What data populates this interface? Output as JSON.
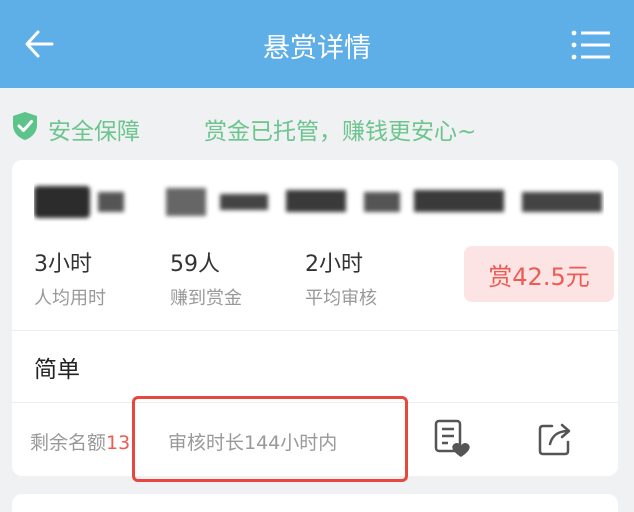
{
  "header": {
    "title": "悬赏详情",
    "back_icon": "arrow-left-icon",
    "menu_icon": "menu-icon",
    "background": "#5eaee8"
  },
  "safety": {
    "label": "安全保障",
    "description": "赏金已托管，赚钱更安心~",
    "color": "#6cc48e"
  },
  "task": {
    "title": "",
    "stats": [
      {
        "value": "3小时",
        "label": "人均用时"
      },
      {
        "value": "59人",
        "label": "赚到赏金"
      },
      {
        "value": "2小时",
        "label": "平均审核"
      }
    ],
    "reward": "赏42.5元",
    "difficulty": "简单",
    "remaining_label": "剩余名额",
    "remaining_count": "13",
    "review_duration": "审核时长144小时内"
  },
  "colors": {
    "accent_red": "#ef5a55",
    "highlight_border": "#e8473e"
  }
}
